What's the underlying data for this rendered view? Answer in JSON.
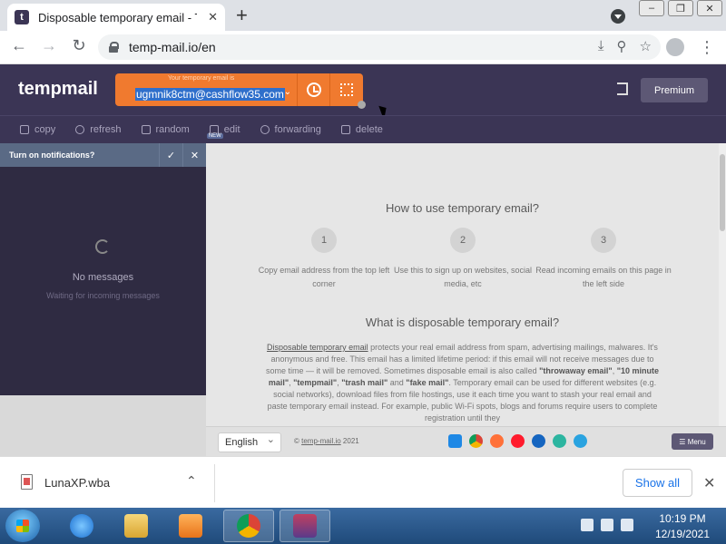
{
  "browser": {
    "tab_title": "Disposable temporary email - Te",
    "tab_favicon_letter": "t",
    "url": "temp-mail.io/en"
  },
  "header": {
    "logo": "tempmail",
    "email_caption": "Your temporary email is",
    "email": "ugmnik8ctm@cashflow35.com",
    "premium_label": "Premium"
  },
  "actions": [
    {
      "label": "copy",
      "icon": "copy-icon"
    },
    {
      "label": "refresh",
      "icon": "refresh-icon"
    },
    {
      "label": "random",
      "icon": "random-icon"
    },
    {
      "label": "edit",
      "icon": "edit-icon",
      "badge": "NEW"
    },
    {
      "label": "forwarding",
      "icon": "forwarding-icon"
    },
    {
      "label": "delete",
      "icon": "trash-icon"
    }
  ],
  "sidebar": {
    "notification": "Turn on notifications?",
    "no_messages": "No messages",
    "waiting": "Waiting for incoming messages"
  },
  "main": {
    "howto_title": "How to use temporary email?",
    "steps": [
      {
        "num": "1",
        "text": "Copy email address from the top left corner"
      },
      {
        "num": "2",
        "text": "Use this to sign up on websites, social media, etc"
      },
      {
        "num": "3",
        "text": "Read incoming emails on this page in the left side"
      }
    ],
    "what_title": "What is disposable temporary email?",
    "what_link": "Disposable temporary email",
    "what_p1": " protects your real email address from spam, advertising mailings, malwares. It's anonymous and free. This email has a limited lifetime period: if this email will not receive messages due to some time — it will be removed. Sometimes disposable email is also called ",
    "kw1": "\"throwaway email\"",
    "sep1": ", ",
    "kw2": "\"10 minute mail\"",
    "sep2": ", ",
    "kw3": "\"tempmail\"",
    "sep3": ", ",
    "kw4": "\"trash mail\"",
    "sep4": " and ",
    "kw5": "\"fake mail\"",
    "what_p2": ". Temporary email can be used for different websites (e.g. social networks), download files from file hostings, use it each time you want to stash your real email and paste temporary email instead. For example, public Wi-Fi spots, blogs and forums require users to complete registration until they"
  },
  "footer": {
    "language": "English",
    "copyright_prefix": "© ",
    "copyright_link": "temp-mail.io",
    "copyright_year": " 2021",
    "menu_label": "Menu"
  },
  "downloads": {
    "file_name": "LunaXP.wba",
    "show_all": "Show all"
  },
  "taskbar": {
    "time": "10:19 PM",
    "date": "12/19/2021"
  },
  "colors": {
    "header_bg": "#3b3555",
    "accent_orange": "#f07a2f",
    "selection_blue": "#2f6fcb"
  }
}
